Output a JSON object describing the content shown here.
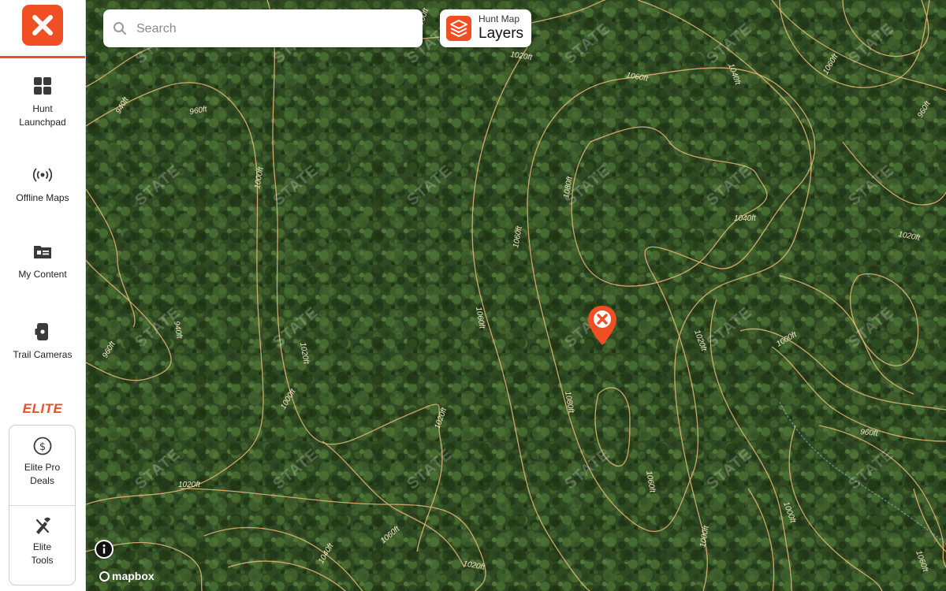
{
  "sidebar": {
    "items": [
      {
        "label": "Hunt\nLaunchpad",
        "icon": "grid-icon"
      },
      {
        "label": "Offline Maps",
        "icon": "broadcast-icon"
      },
      {
        "label": "My Content",
        "icon": "content-folder-icon"
      },
      {
        "label": "Trail Cameras",
        "icon": "camera-icon"
      }
    ],
    "elite_heading": "ELITE",
    "elite_items": [
      {
        "label": "Elite Pro\nDeals",
        "icon": "dollar-circle-icon"
      },
      {
        "label": "Elite\nTools",
        "icon": "tools-icon"
      }
    ]
  },
  "search": {
    "placeholder": "Search"
  },
  "layers": {
    "subtitle": "Hunt Map",
    "title": "Layers"
  },
  "attribution": {
    "brand": "mapbox"
  },
  "map": {
    "contour_labels": [
      {
        "text": "1000ft"
      },
      {
        "text": "1020ft"
      },
      {
        "text": "1040ft"
      },
      {
        "text": "1060ft"
      },
      {
        "text": "1060ft"
      },
      {
        "text": "1000ft"
      },
      {
        "text": "1060ft"
      },
      {
        "text": "1060ft"
      },
      {
        "text": "1080ft"
      },
      {
        "text": "1040ft"
      },
      {
        "text": "1020ft"
      },
      {
        "text": "1020ft"
      },
      {
        "text": "1000ft"
      },
      {
        "text": "940ft"
      },
      {
        "text": "960ft"
      },
      {
        "text": "940ft"
      },
      {
        "text": "960ft"
      },
      {
        "text": "1020ft"
      },
      {
        "text": "1000ft"
      },
      {
        "text": "1020ft"
      },
      {
        "text": "1020ft"
      },
      {
        "text": "1060ft"
      },
      {
        "text": "1080ft"
      },
      {
        "text": "1040ft"
      },
      {
        "text": "1060ft"
      },
      {
        "text": "1020ft"
      },
      {
        "text": "1000ft"
      },
      {
        "text": "960ft"
      },
      {
        "text": "960ft"
      },
      {
        "text": "1000ft"
      },
      {
        "text": "1060ft"
      }
    ],
    "watermark": "STATE",
    "colors": {
      "contour": "#e8b878",
      "accent": "#f04e23",
      "forest": "#2f4a22"
    }
  }
}
